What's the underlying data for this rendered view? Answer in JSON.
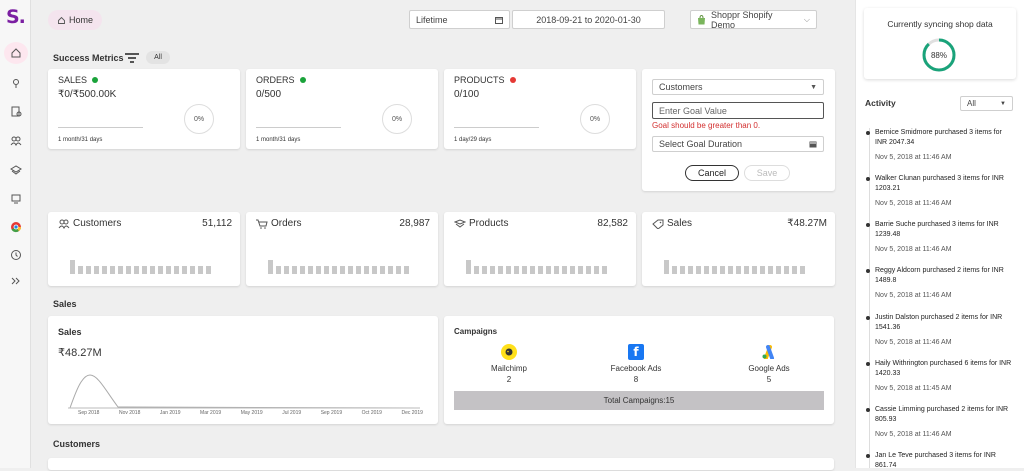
{
  "app": {
    "logo": "S."
  },
  "header": {
    "home_label": "Home",
    "range_select": "Lifetime",
    "date_range": "2018-09-21 to 2020-01-30",
    "store_select": "Shoppr Shopify Demo"
  },
  "success_metrics": {
    "title": "Success Metrics",
    "filter_badge": "All",
    "cards": [
      {
        "label": "SALES",
        "status_color": "#1aa33a",
        "value": "₹0/₹500.00K",
        "percent": "0%",
        "period": "1 month/31 days"
      },
      {
        "label": "ORDERS",
        "status_color": "#1aa33a",
        "value": "0/500",
        "percent": "0%",
        "period": "1 month/31 days"
      },
      {
        "label": "PRODUCTS",
        "status_color": "#e53935",
        "value": "0/100",
        "percent": "0%",
        "period": "1 day/29 days"
      }
    ]
  },
  "goal_form": {
    "select_value": "Customers",
    "goal_placeholder": "Enter Goal Value",
    "error_text": "Goal should be greater than 0.",
    "duration_placeholder": "Select Goal Duration",
    "cancel_label": "Cancel",
    "save_label": "Save"
  },
  "stats": [
    {
      "label": "Customers",
      "icon": "customers-icon",
      "value": "51,112"
    },
    {
      "label": "Orders",
      "icon": "cart-icon",
      "value": "28,987"
    },
    {
      "label": "Products",
      "icon": "box-icon",
      "value": "82,582"
    },
    {
      "label": "Sales",
      "icon": "sales-icon",
      "value": "₹48.27M"
    }
  ],
  "sales_section": {
    "title": "Sales",
    "card_title": "Sales",
    "total": "₹48.27M",
    "x_labels": [
      "Sep 2018",
      "Nov 2018",
      "Jan 2019",
      "Mar 2019",
      "May 2019",
      "Jul 2019",
      "Sep 2019",
      "Oct 2019",
      "Dec 2019"
    ]
  },
  "campaigns": {
    "title": "Campaigns",
    "items": [
      {
        "name": "Mailchimp",
        "count": "2",
        "icon": "mailchimp-icon"
      },
      {
        "name": "Facebook Ads",
        "count": "8",
        "icon": "facebook-icon"
      },
      {
        "name": "Google Ads",
        "count": "5",
        "icon": "google-ads-icon"
      }
    ],
    "total_label": "Total Campaigns:15"
  },
  "customers_section": {
    "title": "Customers"
  },
  "sync": {
    "title": "Currently syncing shop data",
    "percent": "88%",
    "progress": 0.88
  },
  "activity": {
    "title": "Activity",
    "filter": "All",
    "items": [
      {
        "text": "Bernice Smidmore purchased 3 items for INR 2047.34",
        "time": "Nov 5, 2018 at 11:46 AM"
      },
      {
        "text": "Walker Clunan purchased 3 items for INR 1203.21",
        "time": "Nov 5, 2018 at 11:46 AM"
      },
      {
        "text": "Barrie Suche purchased 3 items for INR 1239.48",
        "time": "Nov 5, 2018 at 11:46 AM"
      },
      {
        "text": "Reggy Aldcorn purchased 2 items for INR 1489.8",
        "time": "Nov 5, 2018 at 11:46 AM"
      },
      {
        "text": "Justin Dalston purchased 2 items for INR 1541.36",
        "time": "Nov 5, 2018 at 11:46 AM"
      },
      {
        "text": "Haily Withrington purchased 6 items for INR 1420.33",
        "time": "Nov 5, 2018 at 11:45 AM"
      },
      {
        "text": "Cassie Limming purchased 2 items for INR 805.93",
        "time": "Nov 5, 2018 at 11:46 AM"
      },
      {
        "text": "Jan Le Teve purchased 3 items for INR 861.74",
        "time": ""
      }
    ]
  }
}
